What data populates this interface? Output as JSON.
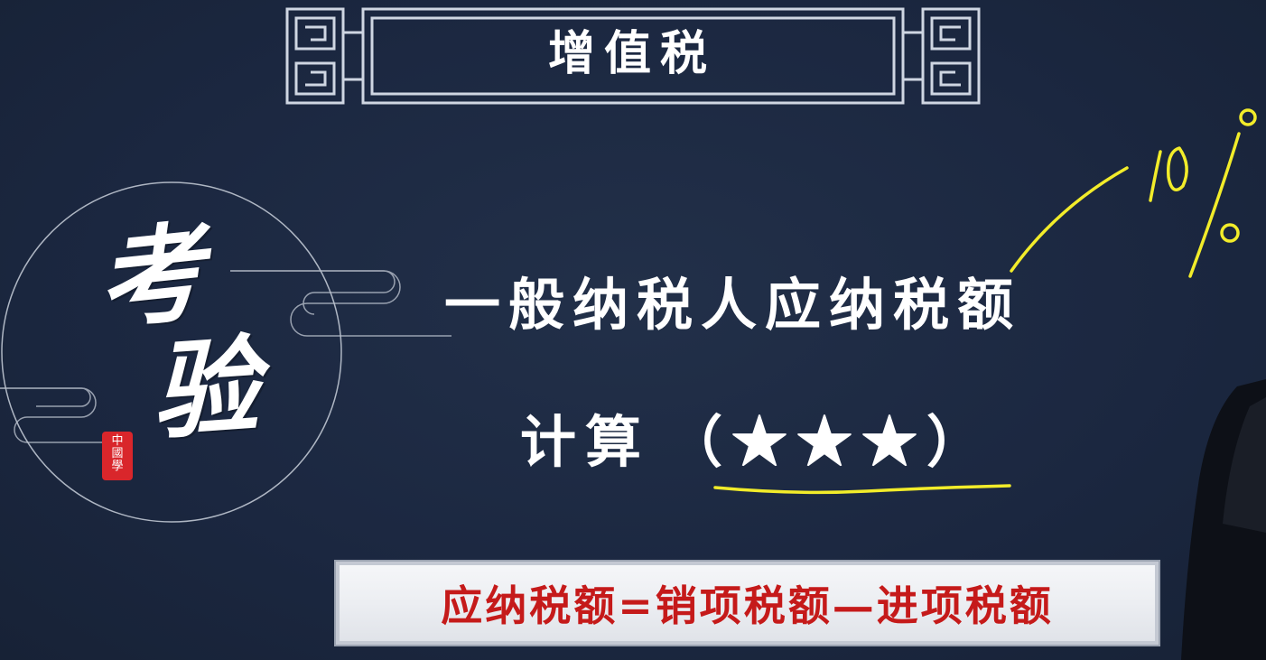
{
  "banner": {
    "title": "增值税"
  },
  "emblem": {
    "char1": "考",
    "char2": "验",
    "seal_line1": "中",
    "seal_line2": "國",
    "seal_line3": "學"
  },
  "topic": {
    "heading": "一般纳税人应纳税额",
    "subheading": "计算",
    "rating": "（★★★）"
  },
  "formula": {
    "text": "应纳税额=销项税额—进项税额"
  },
  "annotation": {
    "handwritten_rate": "10%"
  },
  "colors": {
    "background": "#1b2740",
    "text": "#ffffff",
    "formula_text": "#c51a1a",
    "annotation": "#f2ec2a",
    "seal": "#d9262b"
  }
}
